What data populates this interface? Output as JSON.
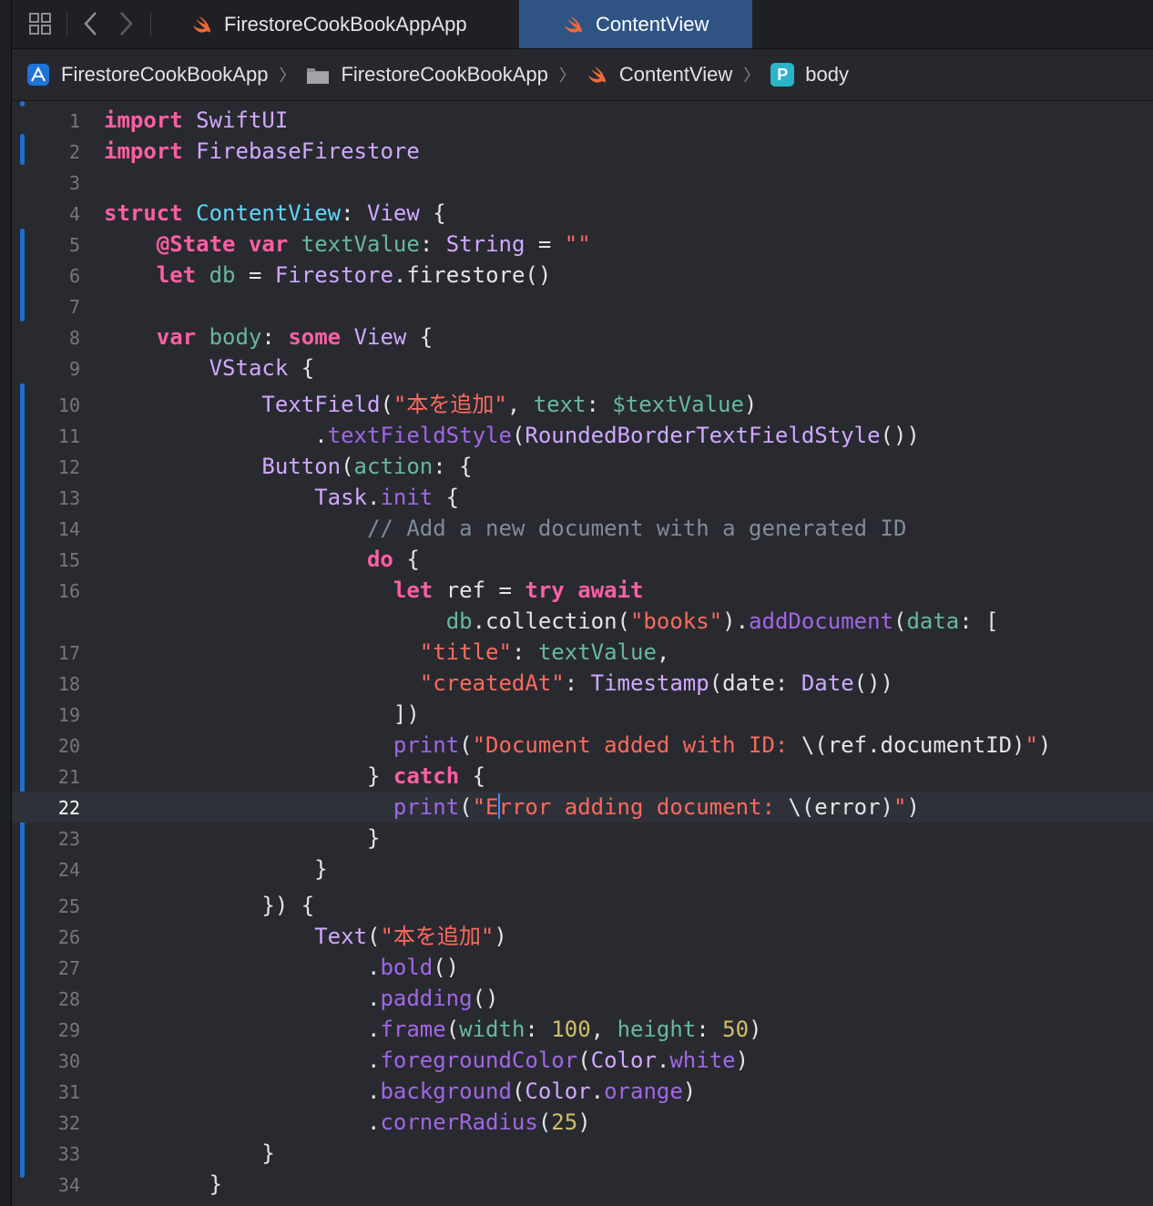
{
  "tabs": [
    {
      "label": "FirestoreCookBookAppApp",
      "icon": "swift-icon",
      "active": false
    },
    {
      "label": "ContentView",
      "icon": "swift-icon",
      "active": true
    }
  ],
  "breadcrumb": [
    {
      "label": "FirestoreCookBookApp",
      "icon": "xcode-project-icon"
    },
    {
      "label": "FirestoreCookBookApp",
      "icon": "folder-icon"
    },
    {
      "label": "ContentView",
      "icon": "swift-icon"
    },
    {
      "label": "body",
      "icon": "property-icon",
      "badge": "P"
    }
  ],
  "editor": {
    "current_line": 22,
    "lines": [
      {
        "n": "1",
        "s": "import SwiftUI"
      },
      {
        "n": "2",
        "s": "import FirebaseFirestore"
      },
      {
        "n": "3",
        "s": ""
      },
      {
        "n": "4",
        "s": "struct ContentView: View {"
      },
      {
        "n": "5",
        "s": "    @State var textValue: String = \"\""
      },
      {
        "n": "6",
        "s": "    let db = Firestore.firestore()"
      },
      {
        "n": "7",
        "s": ""
      },
      {
        "n": "8",
        "s": "    var body: some View {"
      },
      {
        "n": "9",
        "s": "        VStack {"
      },
      {
        "n": "10",
        "s": "            TextField(\"本を追加\", text: $textValue)"
      },
      {
        "n": "11",
        "s": "                .textFieldStyle(RoundedBorderTextFieldStyle())"
      },
      {
        "n": "12",
        "s": "            Button(action: {"
      },
      {
        "n": "13",
        "s": "                Task.init {"
      },
      {
        "n": "14",
        "s": "                    // Add a new document with a generated ID"
      },
      {
        "n": "15",
        "s": "                    do {"
      },
      {
        "n": "16",
        "s": "                      let ref = try await"
      },
      {
        "n": "",
        "s": "                          db.collection(\"books\").addDocument(data: ["
      },
      {
        "n": "17",
        "s": "                        \"title\": textValue,"
      },
      {
        "n": "18",
        "s": "                        \"createdAt\": Timestamp(date: Date())"
      },
      {
        "n": "19",
        "s": "                      ])"
      },
      {
        "n": "20",
        "s": "                      print(\"Document added with ID: \\(ref.documentID)\")"
      },
      {
        "n": "21",
        "s": "                    } catch {"
      },
      {
        "n": "22",
        "s": "                      print(\"Error adding document: \\(error)\")"
      },
      {
        "n": "23",
        "s": "                    }"
      },
      {
        "n": "24",
        "s": "                }"
      },
      {
        "n": "25",
        "s": "            }) {"
      },
      {
        "n": "26",
        "s": "                Text(\"本を追加\")"
      },
      {
        "n": "27",
        "s": "                    .bold()"
      },
      {
        "n": "28",
        "s": "                    .padding()"
      },
      {
        "n": "29",
        "s": "                    .frame(width: 100, height: 50)"
      },
      {
        "n": "30",
        "s": "                    .foregroundColor(Color.white)"
      },
      {
        "n": "31",
        "s": "                    .background(Color.orange)"
      },
      {
        "n": "32",
        "s": "                    .cornerRadius(25)"
      },
      {
        "n": "33",
        "s": "            }"
      },
      {
        "n": "34",
        "s": "        }"
      }
    ]
  },
  "colors": {
    "keyword": "#fc5fa3",
    "type": "#5dd8ff",
    "string": "#fc6a5d",
    "number": "#d0bf69",
    "comment": "#7f8c98",
    "background": "#292a30",
    "active_tab": "#2f5484"
  }
}
